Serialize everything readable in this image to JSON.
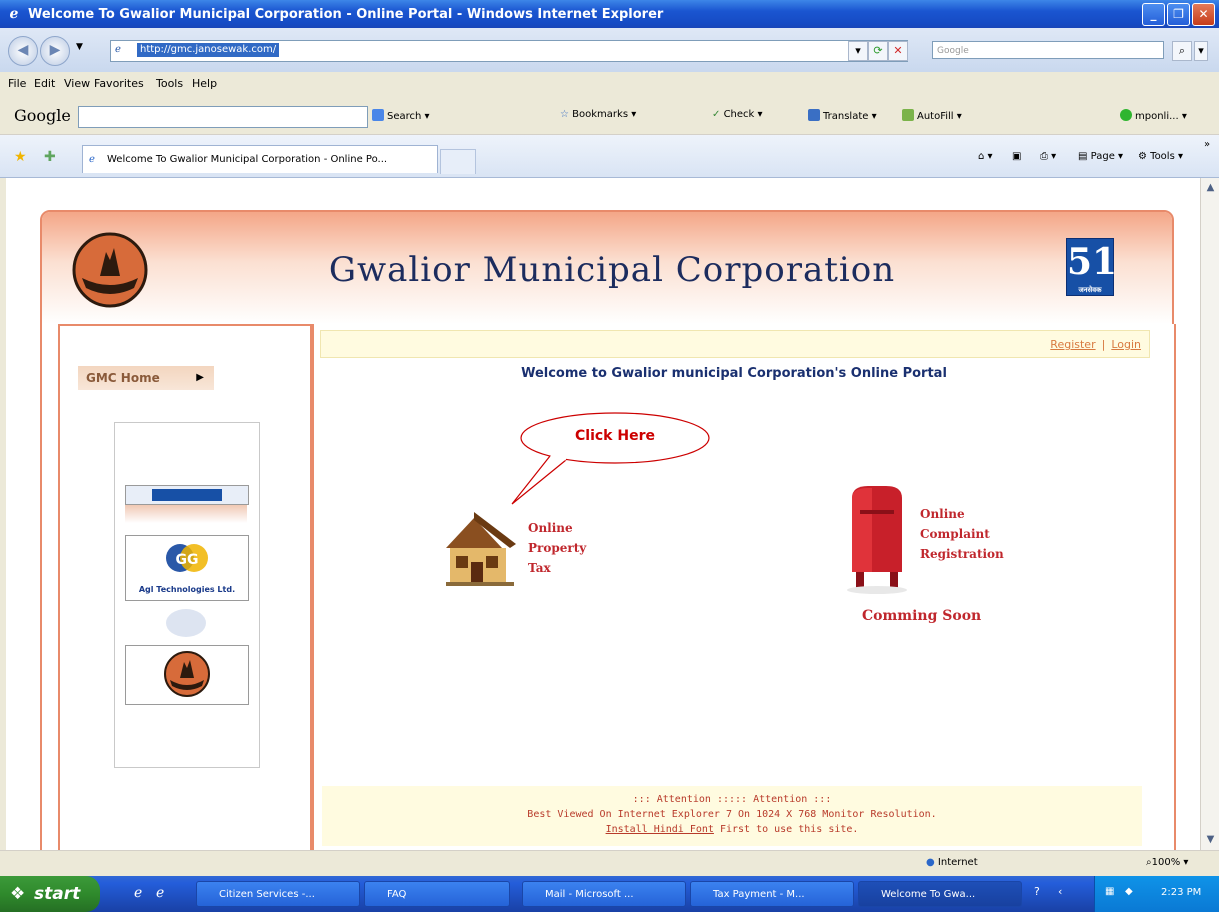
{
  "window": {
    "title": "Welcome To Gwalior Municipal Corporation - Online Portal - Windows Internet Explorer"
  },
  "address": {
    "url": "http://gmc.janosewak.com/",
    "search_placeholder": "Google"
  },
  "menu": [
    "File",
    "Edit",
    "View",
    "Favorites",
    "Tools",
    "Help"
  ],
  "google_toolbar": {
    "logo": "Google",
    "items": [
      "Search",
      "Bookmarks",
      "Check",
      "Translate",
      "AutoFill",
      "mponli..."
    ]
  },
  "tabs": {
    "active": "Welcome To Gwalior Municipal Corporation - Online Po...",
    "tools": [
      "Page",
      "Tools"
    ]
  },
  "page": {
    "site_title": "Gwalior Municipal Corporation",
    "right_logo_text": "51",
    "right_logo_sub": "जनसेवक",
    "nav_home": "GMC Home",
    "register": "Register",
    "login": "Login",
    "sep": "|",
    "welcome": "Welcome to Gwalior municipal Corporation's Online Portal",
    "bubble": "Click Here",
    "property_tax": [
      "Online",
      "Property",
      "Tax"
    ],
    "complaint": [
      "Online",
      "Complaint",
      "Registration"
    ],
    "coming_soon": "Comming Soon",
    "sponsor_text": "Agl Technologies Ltd.",
    "attention_line1": "::: Attention ::::: Attention :::",
    "attention_line2": "Best Viewed On Internet Explorer 7 On 1024 X 768 Monitor Resolution.",
    "attention_link": "Install Hindi Font",
    "attention_line3": " First to use this site."
  },
  "status": {
    "zone": "Internet",
    "zoom": "100%"
  },
  "taskbar": {
    "start": "start",
    "tasks": [
      "Citizen Services -...",
      "FAQ",
      "Mail - Microsoft ...",
      "Tax Payment - M...",
      "Welcome To Gwa..."
    ],
    "clock": "2:23 PM"
  },
  "colors": {
    "accent": "#e88a6a",
    "title_text": "#1c2c5e",
    "option_text": "#c0272d",
    "link": "#d8793f"
  }
}
